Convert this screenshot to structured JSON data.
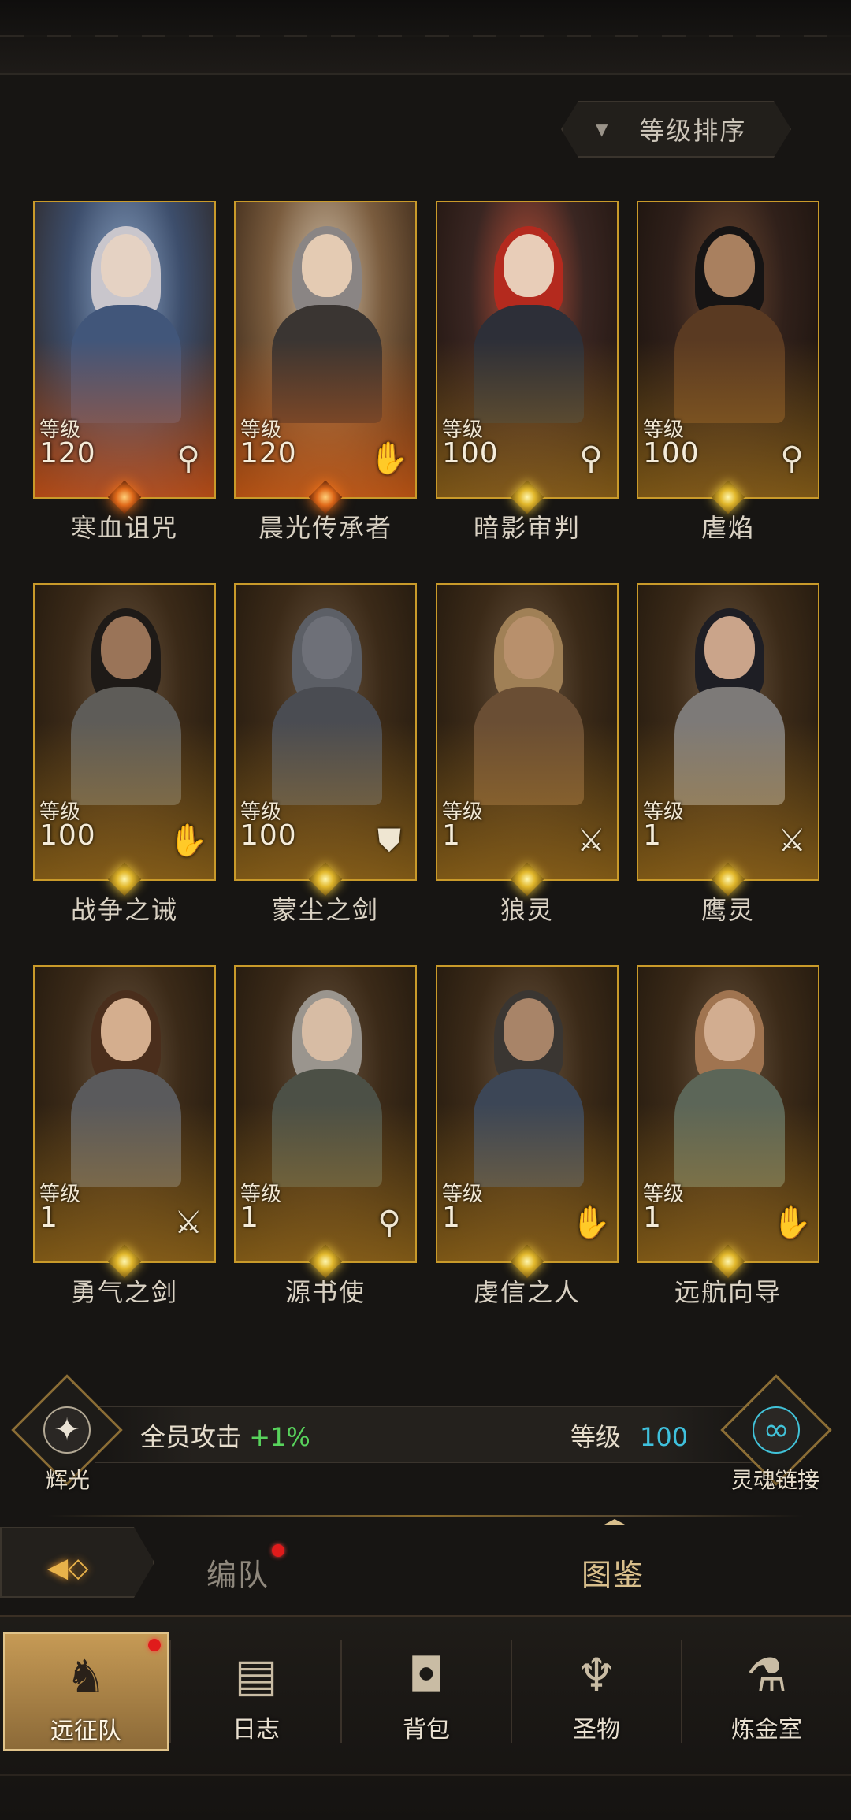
{
  "sort": {
    "label": "等级排序",
    "icon": "triangle-down-icon"
  },
  "level_label": "等级",
  "heroes": [
    {
      "name": "寒血诅咒",
      "level": "120",
      "class_icon": "staff-icon",
      "glyph": "⚲"
    },
    {
      "name": "晨光传承者",
      "level": "120",
      "class_icon": "hand-icon",
      "glyph": "✋"
    },
    {
      "name": "暗影审判",
      "level": "100",
      "class_icon": "staff-icon",
      "glyph": "⚲"
    },
    {
      "name": "虐焰",
      "level": "100",
      "class_icon": "staff-icon",
      "glyph": "⚲"
    },
    {
      "name": "战争之诫",
      "level": "100",
      "class_icon": "hand-icon",
      "glyph": "✋"
    },
    {
      "name": "蒙尘之剑",
      "level": "100",
      "class_icon": "shield-icon",
      "glyph": "⛊"
    },
    {
      "name": "狼灵",
      "level": "1",
      "class_icon": "sword-icon",
      "glyph": "⚔"
    },
    {
      "name": "鹰灵",
      "level": "1",
      "class_icon": "sword-icon",
      "glyph": "⚔"
    },
    {
      "name": "勇气之剑",
      "level": "1",
      "class_icon": "sword-icon",
      "glyph": "⚔"
    },
    {
      "name": "源书使",
      "level": "1",
      "class_icon": "staff-icon",
      "glyph": "⚲"
    },
    {
      "name": "虔信之人",
      "level": "1",
      "class_icon": "hand-icon",
      "glyph": "✋"
    },
    {
      "name": "远航向导",
      "level": "1",
      "class_icon": "hand-icon",
      "glyph": "✋"
    }
  ],
  "bonus": {
    "radiance_label": "辉光",
    "attack_text": "全员攻击",
    "attack_value": "+1%",
    "level_text": "等级",
    "level_value": "100",
    "soul_link_label": "灵魂链接"
  },
  "tabs": {
    "formation": "编队",
    "codex": "图鉴"
  },
  "nav": [
    {
      "label": "远征队",
      "icon": "horned-helmet-icon",
      "glyph": "♞"
    },
    {
      "label": "日志",
      "icon": "scroll-icon",
      "glyph": "▤"
    },
    {
      "label": "背包",
      "icon": "bag-icon",
      "glyph": "◘"
    },
    {
      "label": "圣物",
      "icon": "chalice-icon",
      "glyph": "♆"
    },
    {
      "label": "炼金室",
      "icon": "alchemy-icon",
      "glyph": "⚗"
    }
  ],
  "colors": {
    "gold_frame": "#c99a2a",
    "attack_green": "#58d35c",
    "level_cyan": "#3fc0dc",
    "notification_red": "#e01b1b"
  }
}
